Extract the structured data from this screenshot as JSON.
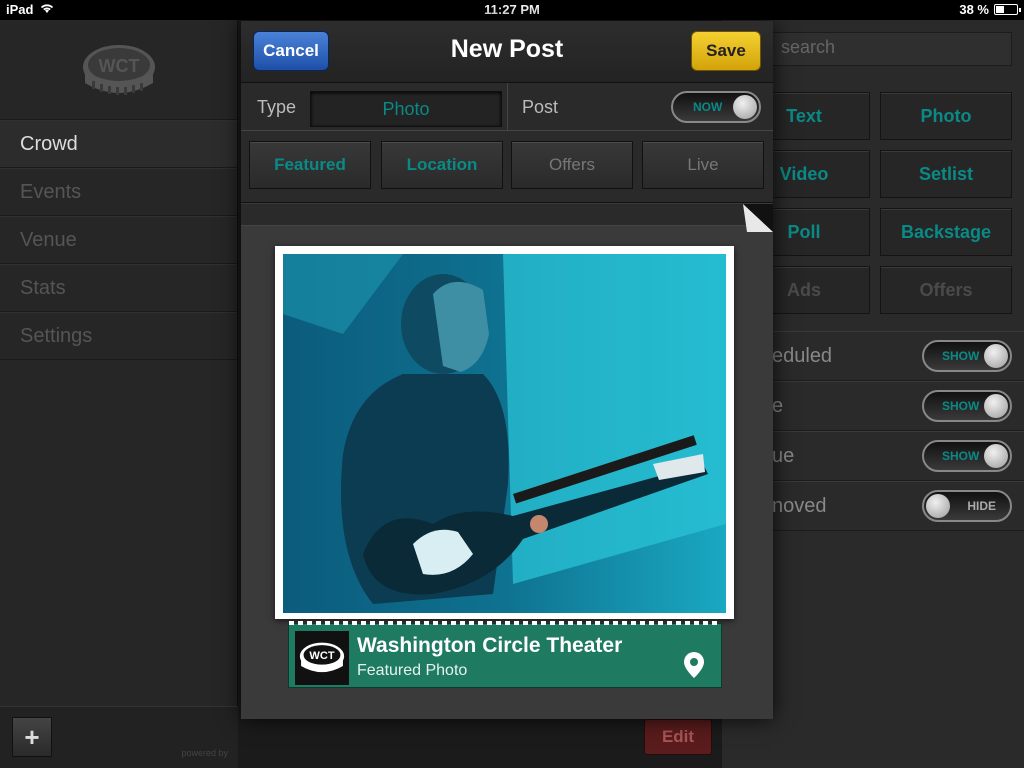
{
  "status_bar": {
    "device": "iPad",
    "time": "11:27 PM",
    "battery_percent": "38 %",
    "battery_level": 0.38
  },
  "sidebar": {
    "logo_text": "WCT",
    "items": [
      {
        "label": "Crowd"
      },
      {
        "label": "Events"
      },
      {
        "label": "Venue"
      },
      {
        "label": "Stats"
      },
      {
        "label": "Settings"
      }
    ],
    "powered_by": "powered by"
  },
  "right_panel": {
    "search_placeholder": "search",
    "type_buttons": [
      {
        "label": "Text",
        "active": true
      },
      {
        "label": "Photo",
        "active": true
      },
      {
        "label": "Video",
        "active": true
      },
      {
        "label": "Setlist",
        "active": true
      },
      {
        "label": "Poll",
        "active": true
      },
      {
        "label": "Backstage",
        "active": true
      },
      {
        "label": "Ads",
        "active": false
      },
      {
        "label": "Offers",
        "active": false
      }
    ],
    "rows": [
      {
        "label": "eduled",
        "toggle": "SHOW"
      },
      {
        "label": "e",
        "toggle": "SHOW"
      },
      {
        "label": "ue",
        "toggle": "SHOW"
      },
      {
        "label": "noved",
        "toggle": "HIDE"
      }
    ]
  },
  "background": {
    "edit_label": "Edit"
  },
  "modal": {
    "title": "New Post",
    "cancel_label": "Cancel",
    "save_label": "Save",
    "type_label": "Type",
    "type_value": "Photo",
    "post_label": "Post",
    "post_toggle": "NOW",
    "filters": [
      {
        "label": "Featured",
        "active": true
      },
      {
        "label": "Location",
        "active": true
      },
      {
        "label": "Offers",
        "active": false
      },
      {
        "label": "Live",
        "active": false
      }
    ],
    "caption": {
      "title": "Washington Circle Theater",
      "subtitle": "Featured Photo"
    }
  },
  "colors": {
    "teal_accent": "#0a8a86",
    "cancel_blue": "#2a5fbd",
    "save_yellow": "#e8c21c",
    "caption_green": "#1f7a62"
  }
}
